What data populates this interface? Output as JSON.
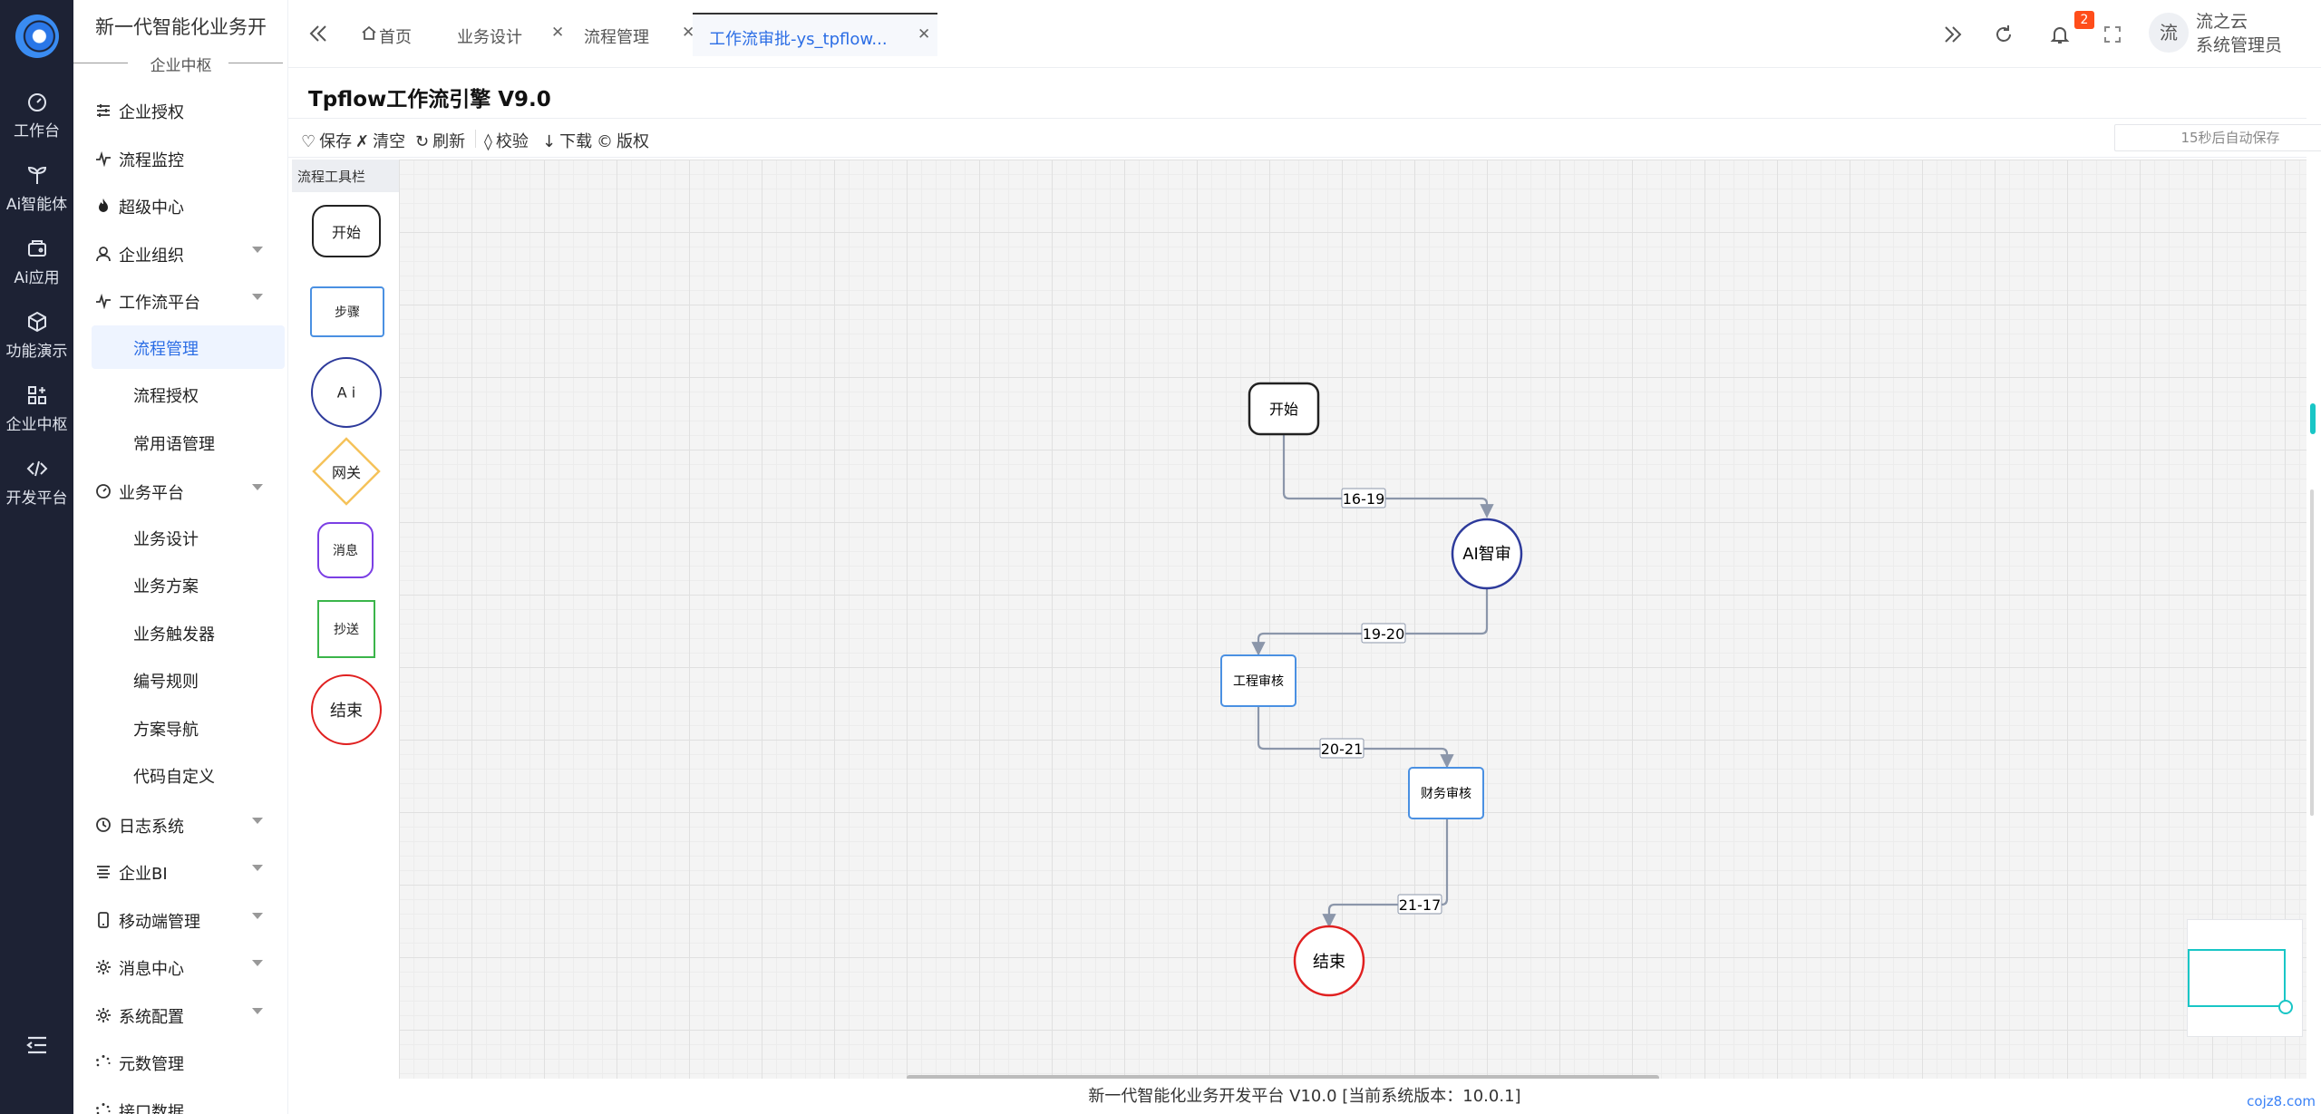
{
  "rail": {
    "items": [
      {
        "label": "工作台",
        "icon": "gauge-icon"
      },
      {
        "label": "Ai智能体",
        "icon": "sprout-icon"
      },
      {
        "label": "Ai应用",
        "icon": "wallet-icon"
      },
      {
        "label": "功能演示",
        "icon": "cube-icon"
      },
      {
        "label": "企业中枢",
        "icon": "grid-plus-icon"
      },
      {
        "label": "开发平台",
        "icon": "code-icon"
      }
    ]
  },
  "sidebar": {
    "brand": "新一代智能化业务开",
    "subtitle": "企业中枢",
    "menu": [
      {
        "label": "企业授权",
        "icon": "sliders-icon",
        "expandable": false
      },
      {
        "label": "流程监控",
        "icon": "pulse-icon",
        "expandable": false
      },
      {
        "label": "超级中心",
        "icon": "flame-icon",
        "expandable": false
      },
      {
        "label": "企业组织",
        "icon": "user-icon",
        "expandable": true
      },
      {
        "label": "工作流平台",
        "icon": "pulse-icon",
        "expandable": true
      },
      {
        "label": "流程管理",
        "sub": true,
        "active": true
      },
      {
        "label": "流程授权",
        "sub": true
      },
      {
        "label": "常用语管理",
        "sub": true
      },
      {
        "label": "业务平台",
        "icon": "dashboard-icon",
        "expandable": true
      },
      {
        "label": "业务设计",
        "sub": true
      },
      {
        "label": "业务方案",
        "sub": true
      },
      {
        "label": "业务触发器",
        "sub": true
      },
      {
        "label": "编号规则",
        "sub": true
      },
      {
        "label": "方案导航",
        "sub": true
      },
      {
        "label": "代码自定义",
        "sub": true
      },
      {
        "label": "日志系统",
        "icon": "clock-icon",
        "expandable": true
      },
      {
        "label": "企业BI",
        "icon": "list-icon",
        "expandable": true
      },
      {
        "label": "移动端管理",
        "icon": "phone-icon",
        "expandable": true
      },
      {
        "label": "消息中心",
        "icon": "gear-icon",
        "expandable": true
      },
      {
        "label": "系统配置",
        "icon": "gear-icon",
        "expandable": true
      },
      {
        "label": "元数管理",
        "icon": "spinner-icon",
        "expandable": false
      },
      {
        "label": "接口数据",
        "icon": "spinner-icon",
        "expandable": false
      }
    ]
  },
  "tabs": [
    {
      "label": "首页",
      "closable": false,
      "home": true
    },
    {
      "label": "业务设计",
      "closable": true
    },
    {
      "label": "流程管理",
      "closable": true
    },
    {
      "label": "工作流审批-ys_tpflow...",
      "closable": true,
      "active": true
    }
  ],
  "header": {
    "notification_count": "2",
    "user_avatar_text": "流",
    "user_name": "流之云",
    "user_role": "系统管理员"
  },
  "page": {
    "title": "Tpflow工作流引擎 V9.0"
  },
  "toolbar": {
    "buttons": [
      {
        "glyph": "♡",
        "label": "保存",
        "name": "save-button"
      },
      {
        "glyph": "✗",
        "label": "清空",
        "name": "clear-button"
      },
      {
        "glyph": "↻",
        "label": "刷新",
        "name": "refresh-button"
      },
      {
        "glyph": "◊",
        "label": "校验",
        "name": "validate-button"
      },
      {
        "glyph": "↓",
        "label": "下载",
        "name": "download-button"
      },
      {
        "glyph": "©",
        "label": "版权",
        "name": "copyright-button"
      }
    ],
    "autosave": "15秒后自动保存",
    "zoom_out": "−",
    "zoom_in": "+"
  },
  "palette": {
    "title": "流程工具栏",
    "items": [
      "开始",
      "步骤",
      "A i",
      "网关",
      "消息",
      "抄送",
      "结束"
    ]
  },
  "flow": {
    "nodes": {
      "start": "开始",
      "ai": "AI智审",
      "eng": "工程审核",
      "fin": "财务审核",
      "end": "结束"
    },
    "edges": [
      "16-19",
      "19-20",
      "20-21",
      "21-17"
    ]
  },
  "footer": "新一代智能化业务开发平台 V10.0 [当前系统版本：10.0.1]",
  "corner": "cojz8.com"
}
